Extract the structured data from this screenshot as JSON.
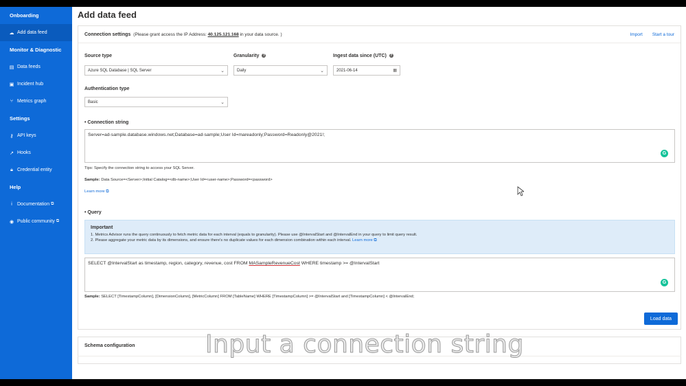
{
  "sidebar": {
    "sections": {
      "onboarding": "Onboarding",
      "monitor": "Monitor & Diagnostic",
      "settings": "Settings",
      "help": "Help"
    },
    "items": {
      "add_data_feed": "Add data feed",
      "data_feeds": "Data feeds",
      "incident_hub": "Incident hub",
      "metrics_graph": "Metrics graph",
      "api_keys": "API keys",
      "hooks": "Hooks",
      "credential_entity": "Credential entity",
      "documentation": "Documentation",
      "public_community": "Public community"
    }
  },
  "page": {
    "title": "Add data feed"
  },
  "connection": {
    "title": "Connection settings",
    "note_prefix": "(Please grant access the IP Address:",
    "ip": "40.125.121.168",
    "note_suffix": "in your data source. )",
    "import": "Import",
    "tour": "Start a tour"
  },
  "form": {
    "source_type_label": "Source type",
    "source_type_value": "Azure SQL Database | SQL Server",
    "granularity_label": "Granularity",
    "granularity_value": "Daily",
    "ingest_label": "Ingest data since (UTC)",
    "ingest_value": "2021-06-14",
    "auth_label": "Authentication type",
    "auth_value": "Basic",
    "conn_string_label": "Connection string",
    "conn_string_value": "Server=ad-sample.database.windows.net;Database=ad-sample;User Id=mareadonly;Password=Readonly@2021!;",
    "tips": "Tips: Specify the connection string to access your SQL Server.",
    "sample_label": "Sample:",
    "sample_value": "Data Source=<Server>;Initial Catalog=<db-name>;User Id=<user-name>;Password=<password>",
    "learn_more": "Learn more",
    "query_label": "Query",
    "important_title": "Important",
    "important_1": "1. Metrics Advisor runs the query continuously to fetch metric data for each interval (equals to granularity). Please use @IntervalStart and @IntervalEnd in your query to limit query result.",
    "important_2": "2. Please aggregate your metric data by its dimensions, and ensure there's no duplicate values for each dimension combination within each interval.",
    "learn_more_2": "Learn more",
    "query_pre": "SELECT @IntervalStart as timestamp, region, category, revenue, cost FROM ",
    "query_table": "MASampleRevenueCost",
    "query_post": " WHERE timestamp >= @IntervalStart",
    "query_sample_label": "Sample:",
    "query_sample_value": "SELECT [TimestampColumn], [DimensionColumn], [MetricColumn] FROM [TableName] WHERE [TimestampColumn] >= @IntervalStart and [TimestampColumn] < @IntervalEnd;",
    "load_data": "Load data"
  },
  "schema": {
    "title": "Schema configuration"
  },
  "caption": "Input a connection string"
}
